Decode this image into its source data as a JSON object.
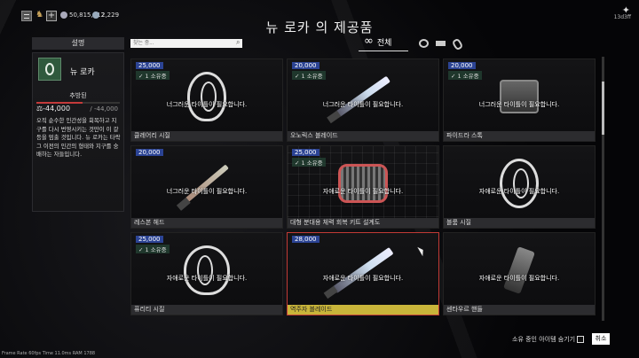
{
  "header": {
    "title": "뉴 로카 의 제공품",
    "credits": "50,815,312",
    "platinum": "2,229",
    "clan_tag": "13d3ff",
    "plus_label": "+"
  },
  "left": {
    "tab_label": "설명",
    "syndicate_name": "뉴 로카",
    "rank": "추방된",
    "standing": "-44,000",
    "standing_max": "/ -44,000",
    "description": "오직 순수한 인간성을 회복하고 지구를 다시 번영시키는 것만이 이 갈등을 멈출 것입니다. 뉴 로카는 타락 그 이전의 인간의 형태와 지구를 숭배하는 자들입니다."
  },
  "search": {
    "placeholder": "찾는 중..."
  },
  "filters": {
    "all_label": "전체",
    "all_icon": "infinity-icon"
  },
  "tiles": [
    {
      "price": "25,000",
      "owned": "1 소유중",
      "need": "너그러운 타이틀이 필요합니다.",
      "name": "클레어리 시질"
    },
    {
      "price": "20,000",
      "owned": "1 소유중",
      "need": "너그러운 타이틀이 필요합니다.",
      "name": "오노릭스 블레이드"
    },
    {
      "price": "20,000",
      "owned": "1 소유중",
      "need": "너그러운 타이틀이 필요합니다.",
      "name": "파이드라 스톡"
    },
    {
      "price": "20,000",
      "owned": "",
      "need": "너그러운 타이틀이 필요합니다.",
      "name": "레스본 헤드"
    },
    {
      "price": "25,000",
      "owned": "1 소유중",
      "need": "자애로운 타이틀이 필요합니다.",
      "name": "대형 분대용 체력 회복 키트 설계도"
    },
    {
      "price": "",
      "owned": "",
      "need": "자애로운 타이틀이 필요합니다.",
      "name": "블룸 시질"
    },
    {
      "price": "25,000",
      "owned": "1 소유중",
      "need": "자애로운 타이틀이 필요합니다.",
      "name": "퓨리티 시질"
    },
    {
      "price": "28,000",
      "owned": "",
      "need": "자애로운 타이틀이 필요합니다.",
      "name": "역주자 블레이드"
    },
    {
      "price": "",
      "owned": "",
      "need": "자애로운 타이틀이 필요합니다.",
      "name": "센타우르 핸들"
    }
  ],
  "footer": {
    "hide_owned_label": "소유 중인 아이템 숨기기",
    "cancel_label": "취소",
    "fps_text": "Frame Rate 60fps Time 11.0ms RAM 1788"
  }
}
